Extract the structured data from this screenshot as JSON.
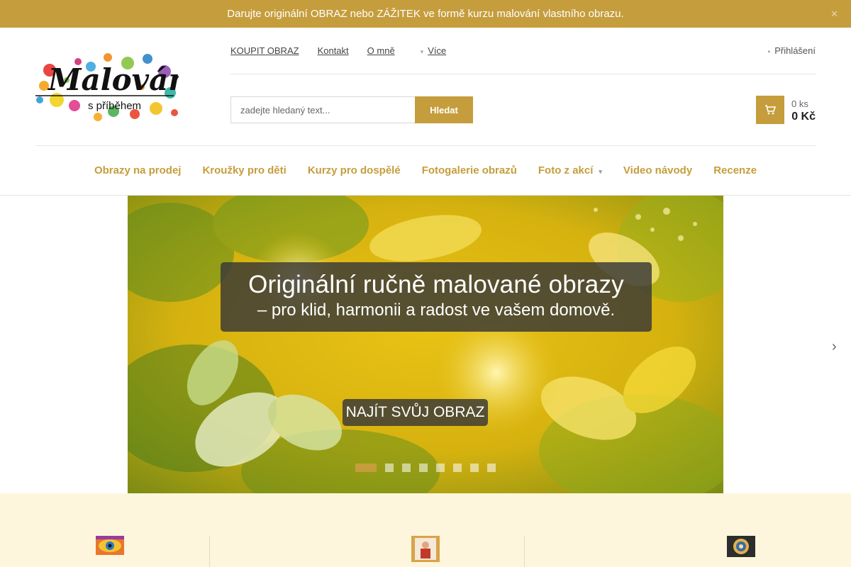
{
  "announcement": {
    "text": "Darujte originální OBRAZ nebo ZÁŽITEK ve formě kurzu malování vlastního obrazu.",
    "close_icon": "close-icon"
  },
  "logo": {
    "title": "Malování",
    "subtitle": "s příběhem"
  },
  "top_links": [
    {
      "label": "KOUPIT OBRAZ"
    },
    {
      "label": "Kontakt"
    },
    {
      "label": "O mně"
    }
  ],
  "more_label": "Více",
  "login_label": "Přihlášení",
  "search": {
    "placeholder": "zadejte hledaný text...",
    "button_label": "Hledat"
  },
  "cart": {
    "count": "0 ks",
    "total": "0 Kč"
  },
  "nav": [
    {
      "label": "Obrazy na prodej"
    },
    {
      "label": "Kroužky pro děti"
    },
    {
      "label": "Kurzy pro dospělé"
    },
    {
      "label": "Fotogalerie obrazů"
    },
    {
      "label": "Foto z akcí"
    },
    {
      "label": "Video návody"
    },
    {
      "label": "Recenze"
    }
  ],
  "hero": {
    "line1": "Originální ručně malované obrazy",
    "line2": "– pro klid, harmonii a radost ve vašem domově.",
    "cta": "NAJÍT SVŮJ OBRAZ",
    "slide_count": 8,
    "active_slide": 1
  },
  "colors": {
    "accent": "#c59d3c",
    "band_bg": "#fdf6dc"
  }
}
